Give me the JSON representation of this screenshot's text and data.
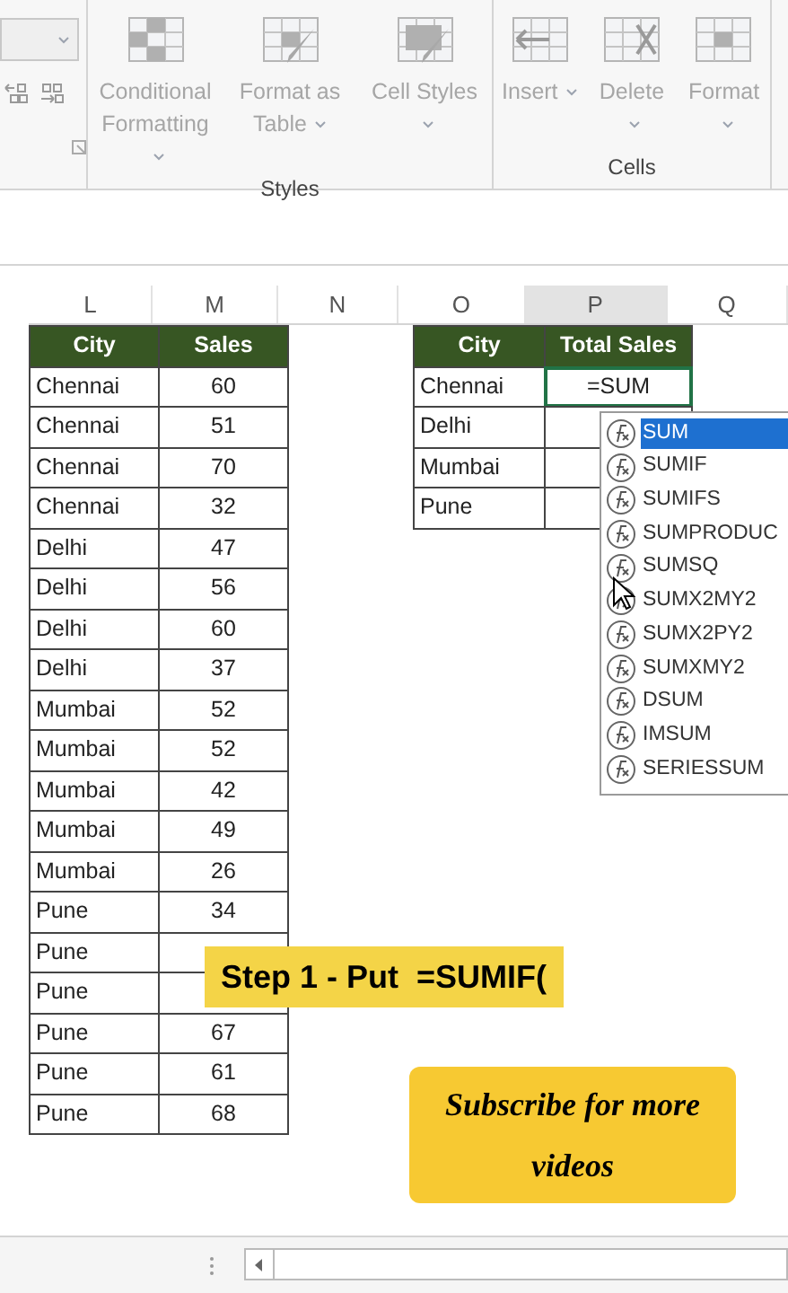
{
  "ribbon": {
    "groups": [
      {
        "label": "Styles",
        "buttons": [
          {
            "label": "Conditional Formatting"
          },
          {
            "label": "Format as Table"
          },
          {
            "label": "Cell Styles"
          }
        ]
      },
      {
        "label": "Cells",
        "buttons": [
          {
            "label": "Insert"
          },
          {
            "label": "Delete"
          },
          {
            "label": "Format"
          }
        ]
      }
    ]
  },
  "column_headers": [
    {
      "label": "L",
      "selected": false
    },
    {
      "label": "M",
      "selected": false
    },
    {
      "label": "N",
      "selected": false
    },
    {
      "label": "O",
      "selected": false
    },
    {
      "label": "P",
      "selected": true
    },
    {
      "label": "Q",
      "selected": false
    }
  ],
  "sales_table": {
    "columns": [
      "City",
      "Sales"
    ],
    "rows": [
      {
        "city": "Chennai",
        "sales": "60"
      },
      {
        "city": "Chennai",
        "sales": "51"
      },
      {
        "city": "Chennai",
        "sales": "70"
      },
      {
        "city": "Chennai",
        "sales": "32"
      },
      {
        "city": "Delhi",
        "sales": "47"
      },
      {
        "city": "Delhi",
        "sales": "56"
      },
      {
        "city": "Delhi",
        "sales": "60"
      },
      {
        "city": "Delhi",
        "sales": "37"
      },
      {
        "city": "Mumbai",
        "sales": "52"
      },
      {
        "city": "Mumbai",
        "sales": "52"
      },
      {
        "city": "Mumbai",
        "sales": "42"
      },
      {
        "city": "Mumbai",
        "sales": "49"
      },
      {
        "city": "Mumbai",
        "sales": "26"
      },
      {
        "city": "Pune",
        "sales": "34"
      },
      {
        "city": "Pune"
      },
      {
        "city": "Pune"
      },
      {
        "city": "Pune",
        "sales": "67"
      },
      {
        "city": "Pune",
        "sales": "61"
      },
      {
        "city": "Pune",
        "sales": "68"
      }
    ]
  },
  "total_table": {
    "columns": [
      "City",
      "Total Sales"
    ],
    "rows": [
      {
        "city": "Chennai",
        "value": "=SUM",
        "selected": true
      },
      {
        "city": "Delhi",
        "selected": false
      },
      {
        "city": "Mumbai",
        "selected": false
      },
      {
        "city": "Pune",
        "selected": false
      }
    ]
  },
  "autocomplete": [
    {
      "label": "SUM",
      "selected": true
    },
    {
      "label": "SUMIF",
      "selected": false
    },
    {
      "label": "SUMIFS",
      "selected": false
    },
    {
      "label": "SUMPRODUC",
      "selected": false
    },
    {
      "label": "SUMSQ",
      "selected": false
    },
    {
      "label": "SUMX2MY2",
      "selected": false
    },
    {
      "label": "SUMX2PY2",
      "selected": false
    },
    {
      "label": "SUMXMY2",
      "selected": false
    },
    {
      "label": "DSUM",
      "selected": false
    },
    {
      "label": "IMSUM",
      "selected": false
    },
    {
      "label": "SERIESSUM",
      "selected": false
    }
  ],
  "captions": [
    {
      "kind": "step",
      "text": "Step 1 - Put  =SUMIF("
    },
    {
      "kind": "subscribe",
      "text": "Subscribe for more videos"
    }
  ]
}
